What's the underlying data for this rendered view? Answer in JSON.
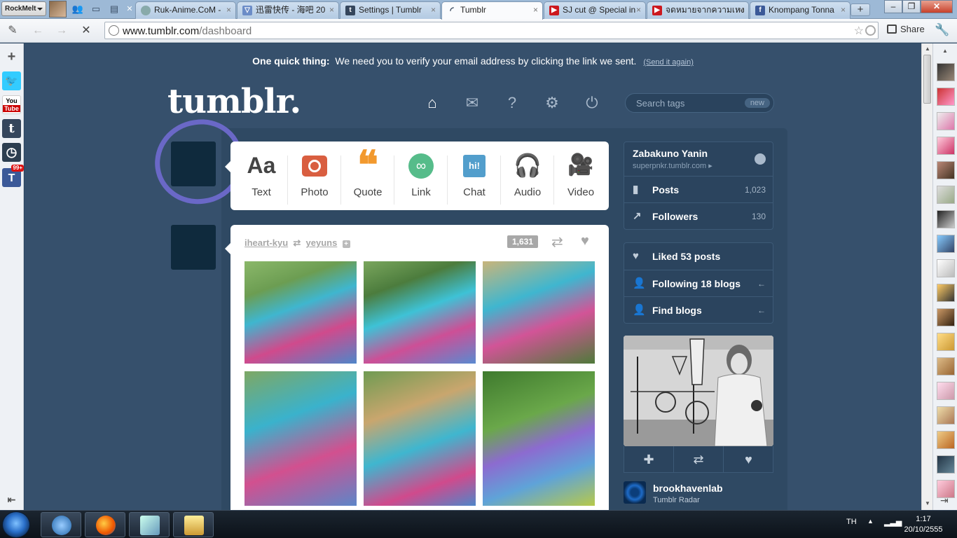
{
  "browser": {
    "menu_label": "RockMelt",
    "tabs": [
      {
        "title": "Ruk-Anime.CoM -",
        "favicon": "globe-icon",
        "color": "#8aa"
      },
      {
        "title": "迅雷快传 - 海吧 20",
        "favicon": "xunlei-icon",
        "color": "#6b8cc7"
      },
      {
        "title": "Settings | Tumblr",
        "favicon": "tumblr-icon",
        "color": "#35465c"
      },
      {
        "title": "Tumblr",
        "favicon": "loading-icon",
        "color": "#35465c"
      },
      {
        "title": "SJ cut @ Special in",
        "favicon": "youtube-icon",
        "color": "#cc181e"
      },
      {
        "title": "จดหมายจากความเหง",
        "favicon": "youtube-icon",
        "color": "#cc181e"
      },
      {
        "title": "Knompang Tonna",
        "favicon": "facebook-icon",
        "color": "#3b5998"
      }
    ],
    "url_host": "www.tumblr.com",
    "url_path": "/dashboard",
    "share_label": "Share"
  },
  "tumblr": {
    "notice_bold": "One quick thing:",
    "notice_text": "We need you to verify your email address by clicking the link we sent.",
    "notice_link": "(Send it again)",
    "logo": "tumblr.",
    "search_placeholder": "Search tags",
    "search_badge": "new",
    "post_types": [
      {
        "label": "Text",
        "icon": "Aa",
        "color": "#444"
      },
      {
        "label": "Photo",
        "icon": "camera-icon",
        "color": "#d95e40"
      },
      {
        "label": "Quote",
        "icon": "❝",
        "color": "#f2992e"
      },
      {
        "label": "Link",
        "icon": "link-icon",
        "color": "#56bc8a"
      },
      {
        "label": "Chat",
        "icon": "hi!",
        "color": "#529ecc"
      },
      {
        "label": "Audio",
        "icon": "headphones-icon",
        "color": "#a77dc2"
      },
      {
        "label": "Video",
        "icon": "video-icon",
        "color": "#748089"
      }
    ],
    "post": {
      "author": "iheart-kyu",
      "reblogged_from": "yeyuns",
      "notes": "1,631"
    },
    "blog": {
      "name": "Zabakuno Yanin",
      "url": "superpnkr.tumblr.com"
    },
    "stats": [
      {
        "label": "Posts",
        "count": "1,023"
      },
      {
        "label": "Followers",
        "count": "130"
      }
    ],
    "links": [
      {
        "label": "Liked 53 posts",
        "count": ""
      },
      {
        "label": "Following 18 blogs",
        "count": "←"
      },
      {
        "label": "Find blogs",
        "count": "←"
      }
    ],
    "radar": {
      "blog": "brookhavenlab",
      "source": "Tumblr Radar"
    }
  },
  "taskbar": {
    "language": "TH",
    "time": "1:17",
    "date": "20/10/2555"
  }
}
